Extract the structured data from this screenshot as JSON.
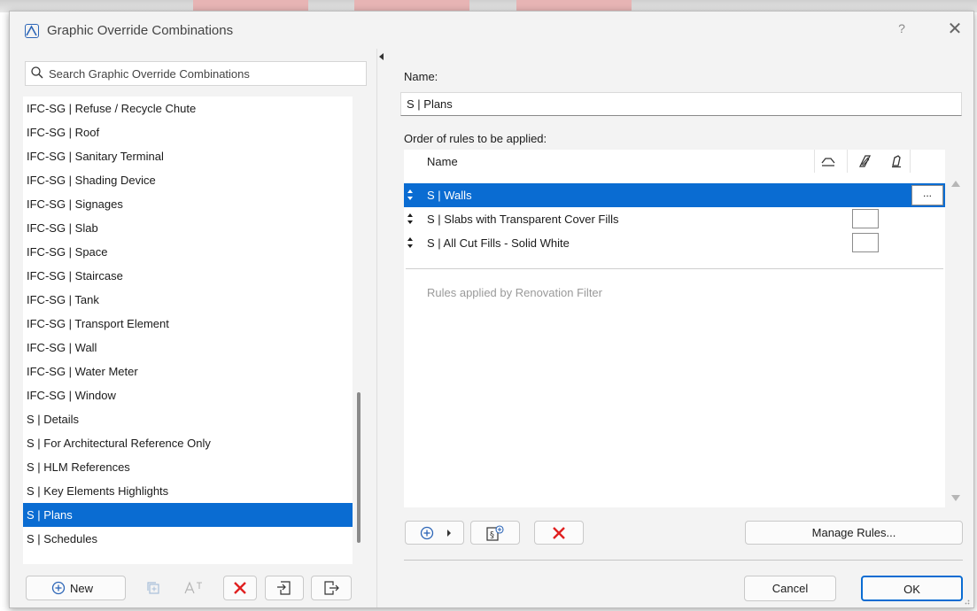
{
  "window": {
    "title": "Graphic Override Combinations",
    "help_label": "?",
    "close_label": "✕"
  },
  "search": {
    "placeholder": "Search Graphic Override Combinations"
  },
  "combinations": [
    "IFC-SG | Refuse / Recycle Chute",
    "IFC-SG | Roof",
    "IFC-SG | Sanitary Terminal",
    "IFC-SG | Shading Device",
    "IFC-SG | Signages",
    "IFC-SG | Slab",
    "IFC-SG | Space",
    "IFC-SG | Staircase",
    "IFC-SG | Tank",
    "IFC-SG | Transport Element",
    "IFC-SG | Wall",
    "IFC-SG | Water Meter",
    "IFC-SG | Window",
    "S | Details",
    "S | For Architectural Reference Only",
    "S | HLM References",
    "S | Key Elements Highlights",
    "S | Plans",
    "S | Schedules"
  ],
  "selected_combination": "S | Plans",
  "left_toolbar": {
    "new_label": "New",
    "icons": [
      "add-circle-icon",
      "duplicate-icon",
      "rename-icon",
      "delete-icon",
      "import-icon",
      "export-icon"
    ]
  },
  "details": {
    "name_label": "Name:",
    "name_value": "S | Plans",
    "rules_label": "Order of rules to be applied:"
  },
  "rules_table": {
    "column_name": "Name",
    "column_icons": [
      "surface-icon",
      "cover-fill-icon",
      "pen-icon"
    ],
    "rows": [
      {
        "name": "S | Walls",
        "selected": true,
        "more_label": "..."
      },
      {
        "name": "S | Slabs with Transparent Cover Fills",
        "selected": false
      },
      {
        "name": "S | All Cut Fills - Solid White",
        "selected": false
      }
    ],
    "renovation_text": "Rules applied by Renovation Filter"
  },
  "right_toolbar": {
    "icons": [
      "add-rule-icon",
      "dropdown-arrow-icon",
      "add-renovation-rule-icon",
      "remove-icon"
    ],
    "manage_rules_label": "Manage Rules..."
  },
  "footer": {
    "cancel_label": "Cancel",
    "ok_label": "OK"
  },
  "colors": {
    "selection": "#0a6cd2",
    "delete_red": "#e02020",
    "accent_blue": "#2d66b7"
  }
}
